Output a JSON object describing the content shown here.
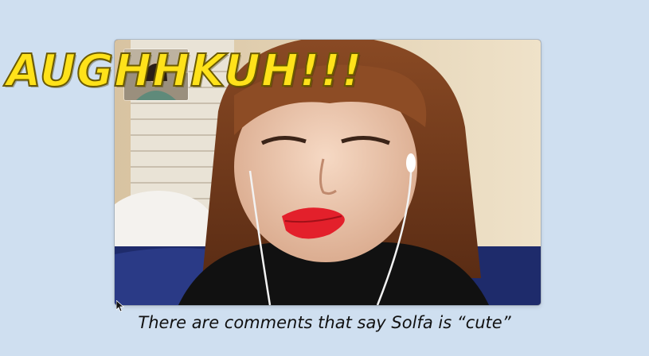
{
  "overlay": {
    "headline": "AUGHHKUH!!!",
    "subtitle": "There are comments that say Solfa is “cute”"
  },
  "video": {
    "main_feed_icon": "person-webcam-feed",
    "self_view_icon": "pip-self-view"
  },
  "colors": {
    "background": "#cfdff0",
    "headline_fill": "#ffe21a",
    "subtitle_text": "#111111"
  }
}
